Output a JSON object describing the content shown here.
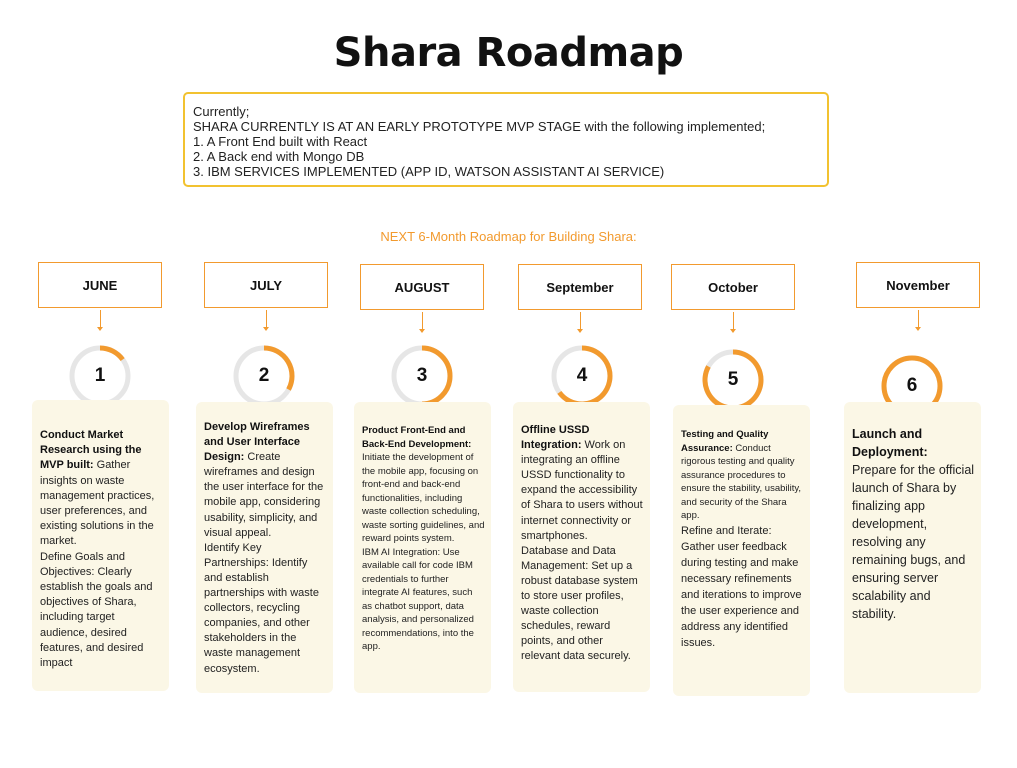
{
  "title": "Shara Roadmap",
  "status": {
    "lines": [
      "Currently;",
      "SHARA CURRENTLY IS AT AN EARLY PROTOTYPE MVP STAGE with the following implemented;",
      "1. A Front End built with React",
      "2. A Back end with Mongo DB",
      "3. IBM SERVICES IMPLEMENTED (APP ID, WATSON ASSISTANT AI SERVICE)"
    ]
  },
  "subtitle": "NEXT 6-Month Roadmap for Building Shara:",
  "colors": {
    "accent": "#f29a2e",
    "ring_track": "#e6e6e6",
    "card_bg": "#fbf7e6",
    "status_border": "#f2c230"
  },
  "steps": [
    {
      "month": "JUNE",
      "number": "1",
      "progress": 0.15,
      "content": [
        {
          "bold": "Conduct Market Research using the MVP built:",
          "text": " Gather insights on waste management practices, user preferences, and existing solutions in the market."
        },
        {
          "bold": "",
          "text": "Define Goals and Objectives: Clearly establish the goals and objectives of Shara, including target audience, desired features, and desired impact"
        }
      ]
    },
    {
      "month": "JULY",
      "number": "2",
      "progress": 0.33,
      "content": [
        {
          "bold": "Develop Wireframes and User Interface Design:",
          "text": " Create wireframes and design the user interface for the mobile app, considering usability, simplicity, and visual appeal."
        },
        {
          "bold": "",
          "text": "Identify Key Partnerships: Identify and establish partnerships with waste collectors, recycling companies, and other stakeholders in the waste management ecosystem."
        }
      ]
    },
    {
      "month": "AUGUST",
      "number": "3",
      "progress": 0.5,
      "content": [
        {
          "bold": "Product Front-End and Back-End Development:",
          "text": " Initiate the development of the mobile app, focusing on front-end and back-end functionalities, including waste collection scheduling, waste sorting guidelines, and reward points system."
        },
        {
          "bold": "",
          "text": "IBM AI Integration: Use available call for code IBM credentials to further integrate AI features, such as chatbot support, data analysis, and personalized recommendations, into the app."
        }
      ]
    },
    {
      "month": "September",
      "number": "4",
      "progress": 0.65,
      "content": [
        {
          "bold": "Offline USSD Integration:",
          "text": " Work on integrating an offline USSD functionality to expand the accessibility of Shara to users without internet connectivity or smartphones."
        },
        {
          "bold": "",
          "text": "Database and Data Management: Set up a robust database system to store user profiles, waste collection schedules, reward points, and other relevant data securely."
        }
      ]
    },
    {
      "month": "October",
      "number": "5",
      "progress": 0.83,
      "content": [
        {
          "bold": "Testing and Quality Assurance:",
          "text": " Conduct rigorous testing and quality assurance procedures to ensure the stability, usability, and security of the Shara app."
        },
        {
          "bold": "",
          "text": "Refine and Iterate: Gather user feedback during testing and make necessary refinements and iterations to improve the user experience and address any identified issues."
        }
      ]
    },
    {
      "month": "November",
      "number": "6",
      "progress": 1.0,
      "content": [
        {
          "bold": "Launch and Deployment:",
          "text": " Prepare for the official launch of Shara by finalizing app development, resolving any remaining bugs, and ensuring server scalability and stability."
        }
      ]
    }
  ]
}
